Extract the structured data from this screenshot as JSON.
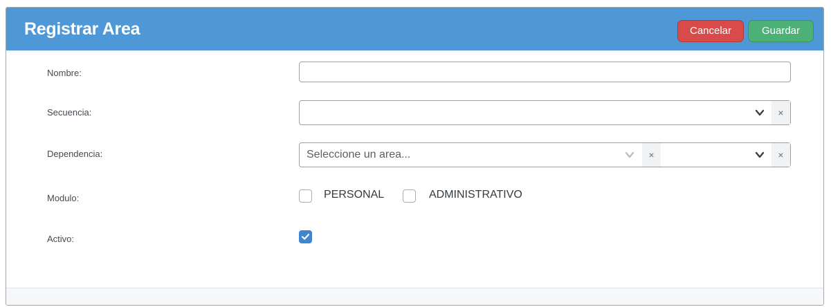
{
  "dialog": {
    "title": "Registrar Area",
    "cancel_label": "Cancelar",
    "save_label": "Guardar"
  },
  "form": {
    "nombre": {
      "label": "Nombre:",
      "value": ""
    },
    "secuencia": {
      "label": "Secuencia:",
      "value": "",
      "clear": "×"
    },
    "dependencia": {
      "label": "Dependencia:",
      "placeholder": "Seleccione un area...",
      "clear_inner": "×",
      "clear_outer": "×"
    },
    "modulo": {
      "label": "Modulo:",
      "options": [
        {
          "label": "PERSONAL",
          "checked": false
        },
        {
          "label": "ADMINISTRATIVO",
          "checked": false
        }
      ]
    },
    "activo": {
      "label": "Activo:",
      "checked": true
    }
  },
  "colors": {
    "header": "#4f98d8",
    "cancel": "#d94b4b",
    "save": "#4cb176",
    "checkbox_checked": "#3f86cf"
  },
  "icons": {
    "dropdown": "chevron-down-icon",
    "clear": "clear-icon",
    "check": "checkmark-icon"
  }
}
